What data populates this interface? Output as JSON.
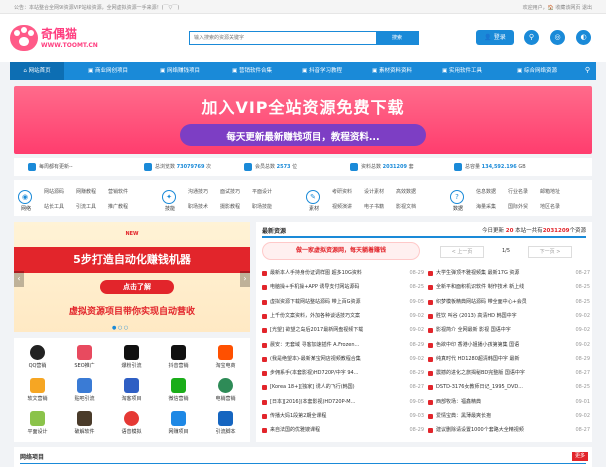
{
  "topbar": {
    "left": "公告：本站整合全网9I资源VIP站绘资源，全网虚拟资源一手来源！(￣▽￣)",
    "right": "欢迎用户，🏠 收藏该网页 退出"
  },
  "logo": {
    "title": "奇偶猫",
    "domain": "WWW.TOOMT.CN"
  },
  "search": {
    "placeholder": "输入搜索的资源关键字",
    "button": "搜索"
  },
  "login": "登录",
  "nav": [
    "网站首页",
    "商业网创项目",
    "网络赚钱项目",
    "营销软件合集",
    "抖音学习教程",
    "素材资料资料",
    "实用软件工具",
    "综合网络资源"
  ],
  "banner": {
    "title": "加入VIP全站资源免费下载",
    "subtitle": "每天更新最新赚钱项目，教程资料..."
  },
  "stats": [
    {
      "label": "每周都有更新--",
      "value": "",
      "unit": ""
    },
    {
      "label": "总浏览数",
      "value": "73079769",
      "unit": "次"
    },
    {
      "label": "会员总数",
      "value": "2573",
      "unit": "位"
    },
    {
      "label": "资料总数",
      "value": "2031209",
      "unit": "套"
    },
    {
      "label": "总容量",
      "value": "134,592.196",
      "unit": "GB"
    }
  ],
  "categories": [
    {
      "name": "网络",
      "links": [
        "网站源码",
        "网赚教程",
        "营销软件",
        "站长工具",
        "引流工具",
        "推广教程"
      ]
    },
    {
      "name": "技能",
      "links": [
        "沟通技巧",
        "面试技巧",
        "平面设计",
        "职场技术",
        "摄影教程",
        "职场技能"
      ]
    },
    {
      "name": "素材",
      "links": [
        "考研资料",
        "设计素材",
        "高效数据",
        "视频演讲",
        "电子书籍",
        "影视文档"
      ]
    },
    {
      "name": "数据",
      "links": [
        "信息数据",
        "行业名录",
        "邮箱地址",
        "海量采集",
        "国际外贸",
        "地区名录"
      ]
    }
  ],
  "slider": {
    "new": "NEW",
    "title": "5步打造自动化赚钱机器",
    "cta": "点击了解",
    "sub": "虚拟资源项目带你实现自动营收"
  },
  "apps": [
    "QQ营销",
    "SEO推广",
    "爆粉引流",
    "抖音营销",
    "淘宝电商",
    "软文营销",
    "贴吧引流",
    "淘客项目",
    "微信营销",
    "电销营销",
    "平面设计",
    "破解软件",
    "语音模拟",
    "网赚项目",
    "引流脚本"
  ],
  "panel": {
    "title": "最新资源",
    "today_prefix": "今日更新",
    "today_count": "20",
    "today_mid": "本站一共有",
    "total": "2031209",
    "total_suffix": "个资源"
  },
  "hot_button": "做一家虚拟资源网，每天躺着赚钱",
  "pager": {
    "prev": "< 上一页",
    "page": "1/5",
    "next": "下一页 >"
  },
  "list_left": [
    {
      "title": "最新本人手持身份证调样图 超多10G资料",
      "date": "08-29"
    },
    {
      "title": "电脑操+手机操+APP 诱导支付网站源码",
      "date": "08-25"
    },
    {
      "title": "虚拟资源下载网站整站源码 带上百G资源",
      "date": "09-05"
    },
    {
      "title": "上千份文案资料，外加各种谈话技巧文案",
      "date": "09-02"
    },
    {
      "title": "[光望] 欲望之岛后2017最新网盘视频下载",
      "date": "09-02"
    },
    {
      "title": "晨安：无套域 寻客加速插件 A.Frozen...",
      "date": "08-29"
    },
    {
      "title": "(我是绝望本)-最新某宝网店视频教程合集",
      "date": "09-02"
    },
    {
      "title": "步佣系手(本套影视)HD720P/中字 94...",
      "date": "08-29"
    },
    {
      "title": "[Korea 18+][独家] 诱人的飞行(韩国)",
      "date": "08-27"
    },
    {
      "title": "[日本][2016](本套影视)HD720P-M...",
      "date": "09-05"
    },
    {
      "title": "传播大妈1段第2期全课程",
      "date": "09-03"
    },
    {
      "title": "来自法国的优雅嫂课程",
      "date": "08-29"
    }
  ],
  "list_right": [
    {
      "title": "大学生弹顶不雅视频集 最新17G 资源",
      "date": "08-27"
    },
    {
      "title": "全新平和面积机识软件 制作技术 新上线",
      "date": "08-25"
    },
    {
      "title": "织梦模板精典网站源码 带全面中心+会员",
      "date": "08-25"
    },
    {
      "title": "胜饮 叫谷 (2013) 高清HD 韩国中字",
      "date": "09-02"
    },
    {
      "title": "影视简介 全网最新 影视 国语中字",
      "date": "09-02"
    },
    {
      "title": "色欲中印 香港小姐播小孩第第集 国语",
      "date": "09-02"
    },
    {
      "title": "纯真时代 HD1280超清韩国中字 最新",
      "date": "08-29"
    },
    {
      "title": "震撼的进化之旅揭秘BD完整版 国语中字",
      "date": "08-27"
    },
    {
      "title": "DSTD-3176女教师日记_1995_DVD...",
      "date": "08-25"
    },
    {
      "title": "西部牧场：福鑫精典",
      "date": "09-01"
    },
    {
      "title": "爱情宝典：黑薄最爽长孢",
      "date": "09-02"
    },
    {
      "title": "建议删除请设置1000个套路大全精视频",
      "date": "08-27"
    }
  ],
  "bottom": {
    "title": "网络项目",
    "more": "更多"
  }
}
